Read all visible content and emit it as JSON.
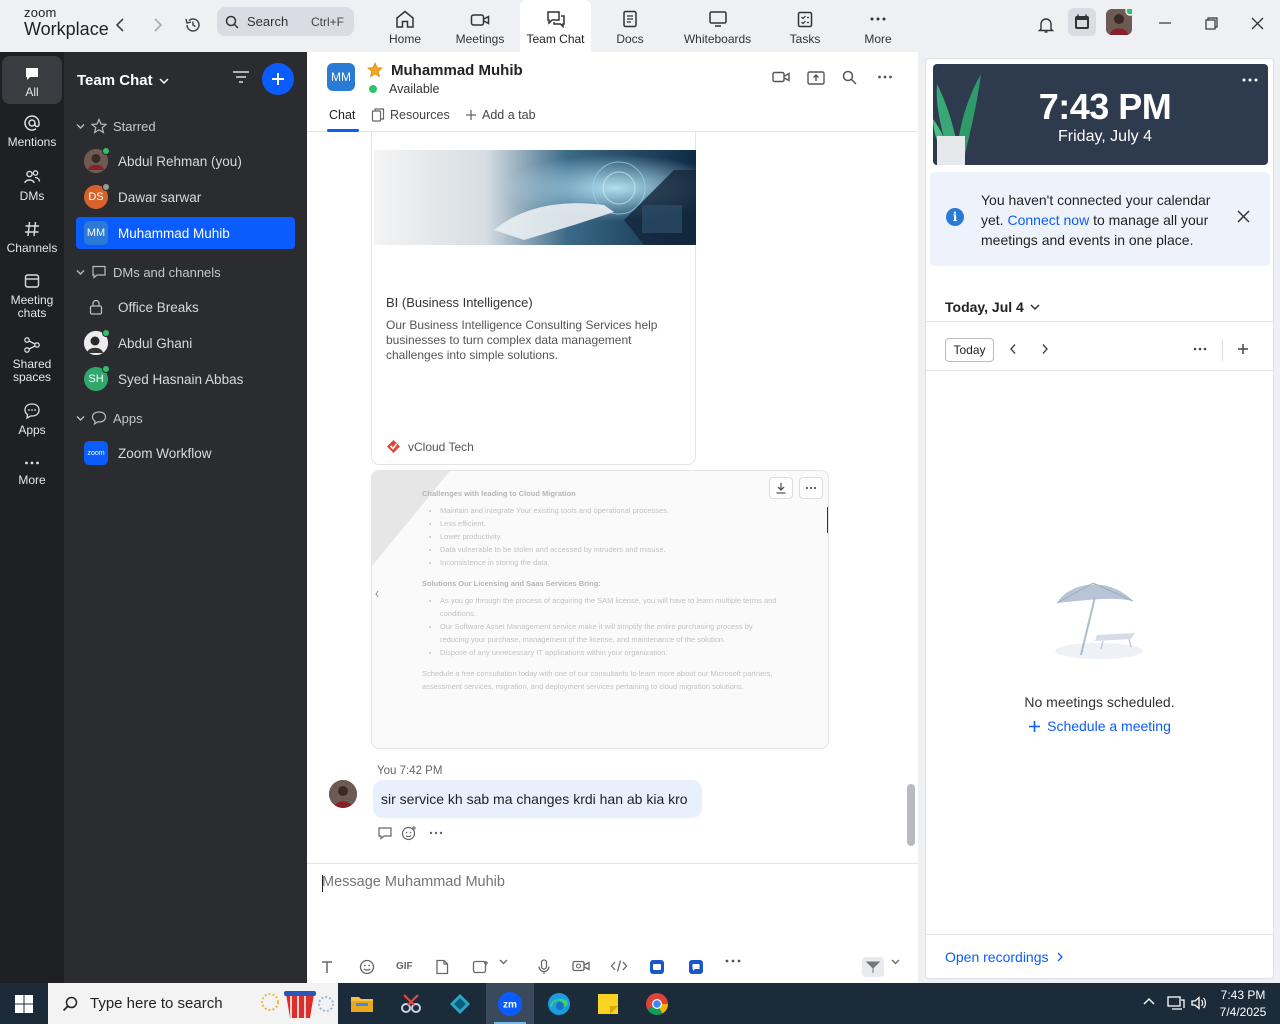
{
  "app": {
    "logo_top": "zoom",
    "logo_bottom": "Workplace",
    "search_label": "Search",
    "search_shortcut": "Ctrl+F"
  },
  "nav": {
    "tabs": [
      {
        "label": "Home",
        "icon": "home-icon"
      },
      {
        "label": "Meetings",
        "icon": "video-icon"
      },
      {
        "label": "Team Chat",
        "icon": "chat-icon"
      },
      {
        "label": "Docs",
        "icon": "doc-icon"
      },
      {
        "label": "Whiteboards",
        "icon": "whiteboard-icon"
      },
      {
        "label": "Tasks",
        "icon": "tasks-icon"
      },
      {
        "label": "More",
        "icon": "more-icon"
      }
    ],
    "active_tab": "Team Chat"
  },
  "rail": {
    "items": [
      {
        "label": "All"
      },
      {
        "label": "Mentions"
      },
      {
        "label": "DMs"
      },
      {
        "label": "Channels"
      },
      {
        "label": "Meeting chats"
      },
      {
        "label": "Shared spaces"
      },
      {
        "label": "Apps"
      },
      {
        "label": "More"
      }
    ]
  },
  "sidebar": {
    "title": "Team Chat",
    "sections": {
      "starred": "Starred",
      "dms": "DMs and channels",
      "apps": "Apps"
    },
    "starred": [
      {
        "name": "Abdul Rehman (you)",
        "initials": "",
        "color": "#7a4b3a",
        "status": "online"
      },
      {
        "name": "Dawar sarwar",
        "initials": "DS",
        "color": "#d9622b",
        "status": "away"
      },
      {
        "name": "Muhammad Muhib",
        "initials": "MM",
        "color": "#2b7bd6",
        "status": "",
        "selected": true
      }
    ],
    "dms": [
      {
        "name": "Office Breaks",
        "kind": "lock-channel"
      },
      {
        "name": "Abdul Ghani",
        "initials": "",
        "color": "#e6e6e6",
        "status": "online"
      },
      {
        "name": "Syed Hasnain Abbas",
        "initials": "SH",
        "color": "#2fa86b",
        "status": "online"
      }
    ],
    "apps": [
      {
        "name": "Zoom Workflow",
        "initials": "zoom",
        "color": "#0b5cff"
      }
    ]
  },
  "chat": {
    "contact_initials": "MM",
    "contact_name": "Muhammad Muhib",
    "contact_status": "Available",
    "tabs": {
      "chat": "Chat",
      "resources": "Resources",
      "add": "Add a tab"
    },
    "card": {
      "title": "BI  (Business Intelligence)",
      "description": "Our Business Intelligence Consulting Services help businesses to turn complex data management challenges into simple solutions.",
      "source": "vCloud Tech"
    },
    "doc_preview": {
      "heading1": "Challenges with leading to Cloud Migration",
      "bullets1": [
        "Maintain and integrate Your existing tools and operational processes.",
        "Less efficient.",
        "Lower productivity.",
        "Data vulnerable to be stolen and accessed by intruders and misuse.",
        "Inconsistence in storing the data."
      ],
      "heading2": "Solutions Our Licensing and Saas Services Bring:",
      "bullets2": [
        "As you go through the process of acquiring the SAM license, you will have to learn multiple terms and conditions.",
        "Our Software Asset Management service make it will simplify the entire purchasing process by reducing your purchase, management of the license, and maintenance of the solution.",
        "Dispose of any unnecessary IT applications within your organization."
      ],
      "footer": "Schedule a free consultation today with one of our consultants to learn more about our Microsoft partners, assessment services, migration, and deployment services pertaining to cloud migration solutions."
    },
    "message": {
      "sender": "You",
      "time": "7:42 PM",
      "text": "sir service kh sab ma changes krdi han ab kia kro"
    },
    "composer_placeholder": "Message Muhammad Muhib"
  },
  "calendar": {
    "time": "7:43 PM",
    "date": "Friday, July 4",
    "notice_pre": "You haven't connected your calendar yet. ",
    "notice_link": "Connect now",
    "notice_post": " to manage all your meetings and events in one place.",
    "day_label": "Today, Jul 4",
    "today_btn": "Today",
    "empty": "No meetings scheduled.",
    "schedule": "Schedule a meeting",
    "open_recordings": "Open recordings"
  },
  "taskbar": {
    "search_placeholder": "Type here to search",
    "time": "7:43 PM",
    "date": "7/4/2025"
  }
}
